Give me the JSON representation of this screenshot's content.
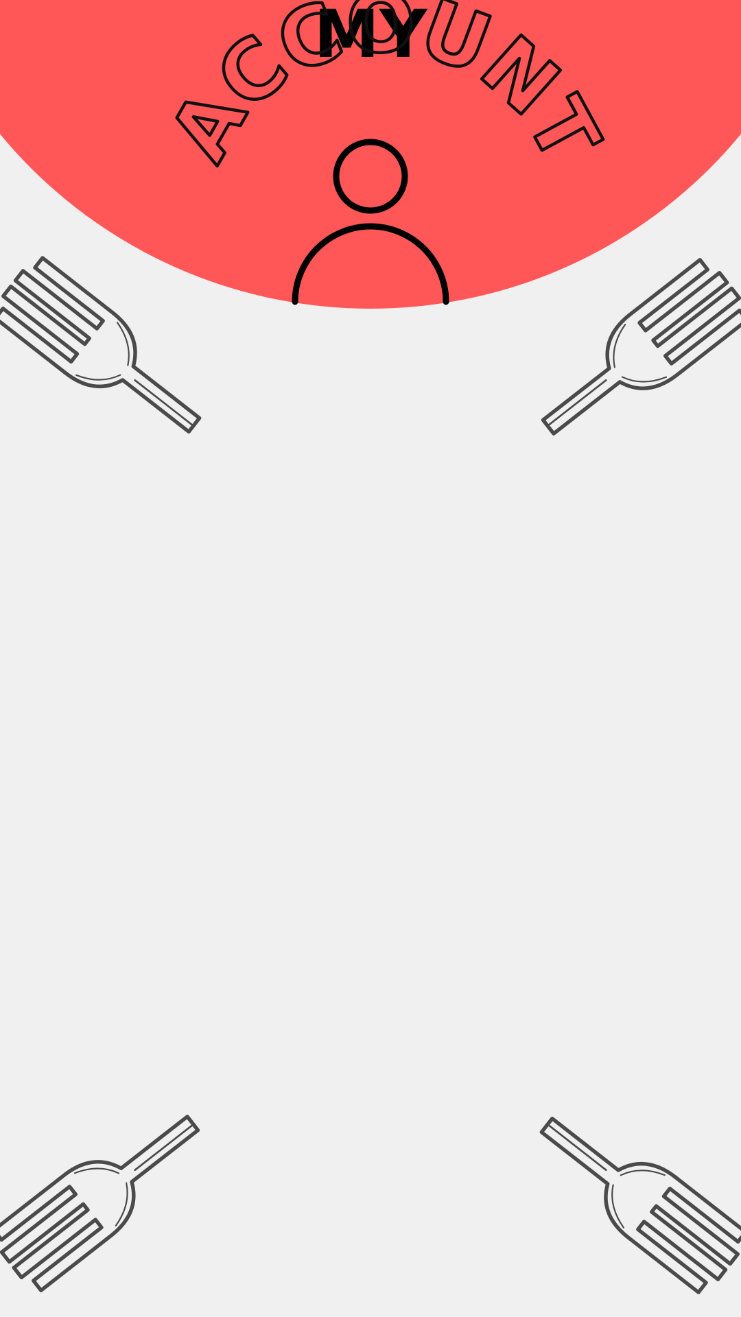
{
  "page": {
    "background_color": "#f0f0f0",
    "accent_color": "#ff5757"
  },
  "header": {
    "title_line1": "MY",
    "title_line2": "ACCOUNT"
  },
  "icons": {
    "avatar": "user-avatar-icon",
    "decoration": "fork-icon"
  }
}
